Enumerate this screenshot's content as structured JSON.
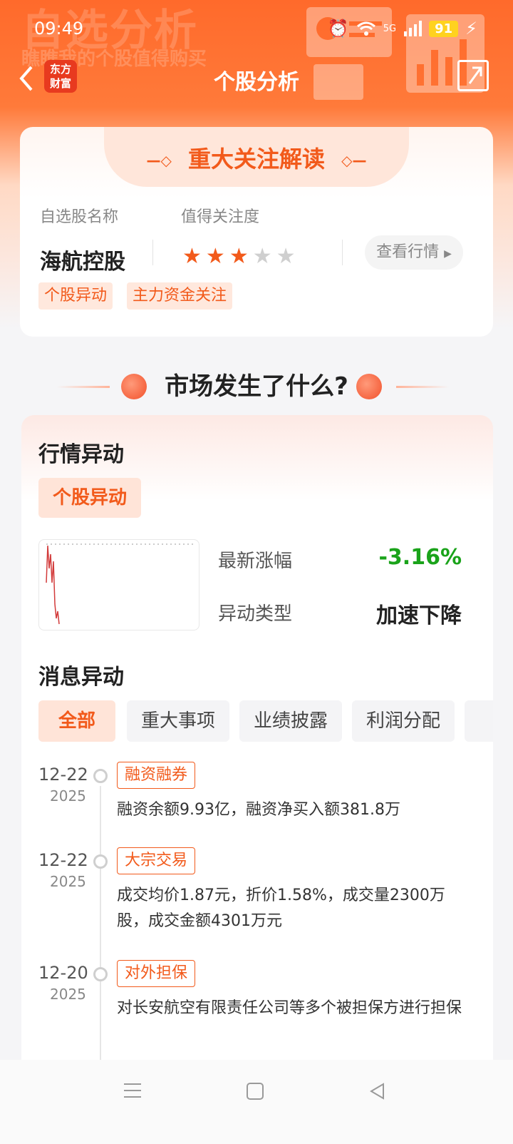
{
  "status_bar": {
    "time": "09:49",
    "network": "5G",
    "battery": "91"
  },
  "header": {
    "watermark_title": "自选分析",
    "watermark_subtitle": "瞧瞧我的个股值得购买",
    "logo_line1": "东方",
    "logo_line2": "财富",
    "title": "个股分析"
  },
  "focus_card": {
    "title": "重大关注解读",
    "name_label": "自选股名称",
    "attention_label": "值得关注度",
    "stock_name": "海航控股",
    "stars_on": 3,
    "stars_total": 5,
    "quote_button": "查看行情",
    "tags": [
      "个股异动",
      "主力资金关注"
    ]
  },
  "market_section": {
    "title": "市场发生了什么?"
  },
  "market_card": {
    "heading": "行情异动",
    "pill": "个股异动",
    "latest_change_label": "最新涨幅",
    "latest_change_value": "-3.16%",
    "change_type_label": "异动类型",
    "change_type_value": "加速下降",
    "news_heading": "消息异动",
    "chips": [
      "全部",
      "重大事项",
      "业绩披露",
      "利润分配"
    ],
    "timeline": [
      {
        "date": "12-22",
        "year": "2025",
        "tag": "融资融券",
        "text": "融资余额9.93亿，融资净买入额381.8万"
      },
      {
        "date": "12-22",
        "year": "2025",
        "tag": "大宗交易",
        "text": "成交均价1.87元，折价1.58%，成交量2300万股，成交金额4301万元"
      },
      {
        "date": "12-20",
        "year": "2025",
        "tag": "对外担保",
        "text": "对长安航空有限责任公司等多个被担保方进行担保"
      }
    ]
  },
  "colors": {
    "accent": "#f25a1b",
    "negative": "#1aa31a",
    "header_bg": "#ff6a2b"
  }
}
